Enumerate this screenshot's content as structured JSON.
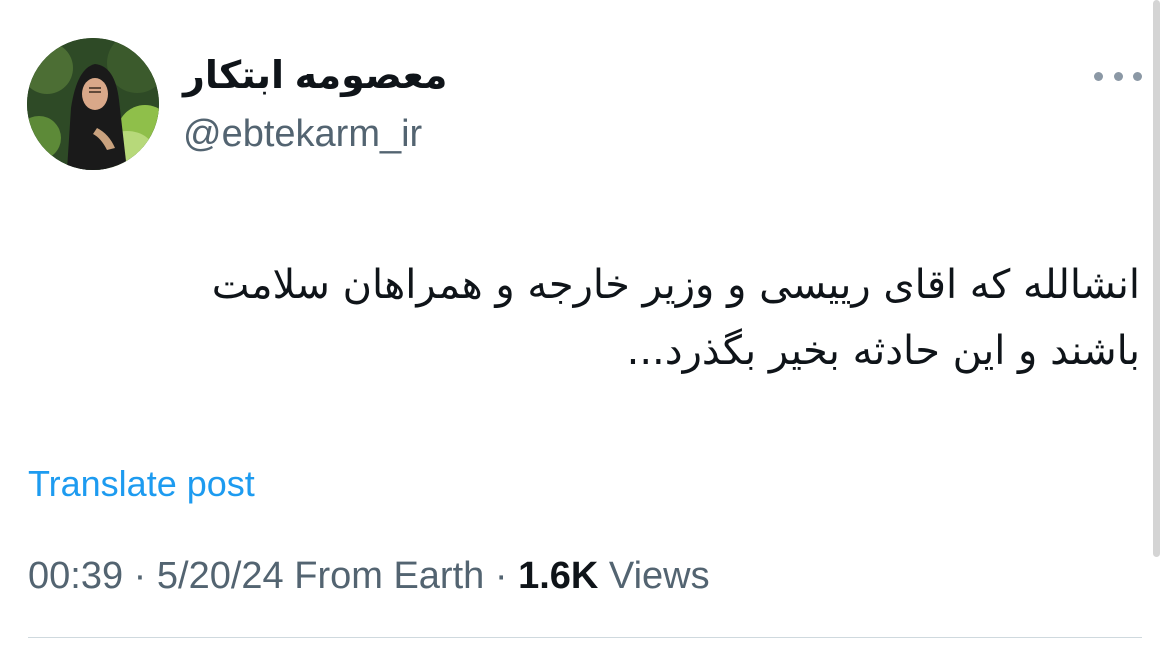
{
  "author": {
    "display_name": "معصومه ابتکار",
    "handle": "@ebtekarm_ir",
    "avatar_icon": "profile-photo"
  },
  "post": {
    "text_lines": [
      "انشالله که اقای رییسی و وزیر خارجه و همراهان سلامت",
      "باشند و این حادثه بخیر بگذرد..."
    ],
    "translate_label": "Translate post"
  },
  "meta": {
    "time": "00:39",
    "separator": "·",
    "date": "5/20/24",
    "source": "From Earth",
    "views_count": "1.6K",
    "views_label": "Views"
  },
  "more_icon": "ellipsis-icon",
  "colors": {
    "accent": "#1d9bf0",
    "text": "#0f1419",
    "secondary": "#536471",
    "divider": "#cfd9de"
  }
}
